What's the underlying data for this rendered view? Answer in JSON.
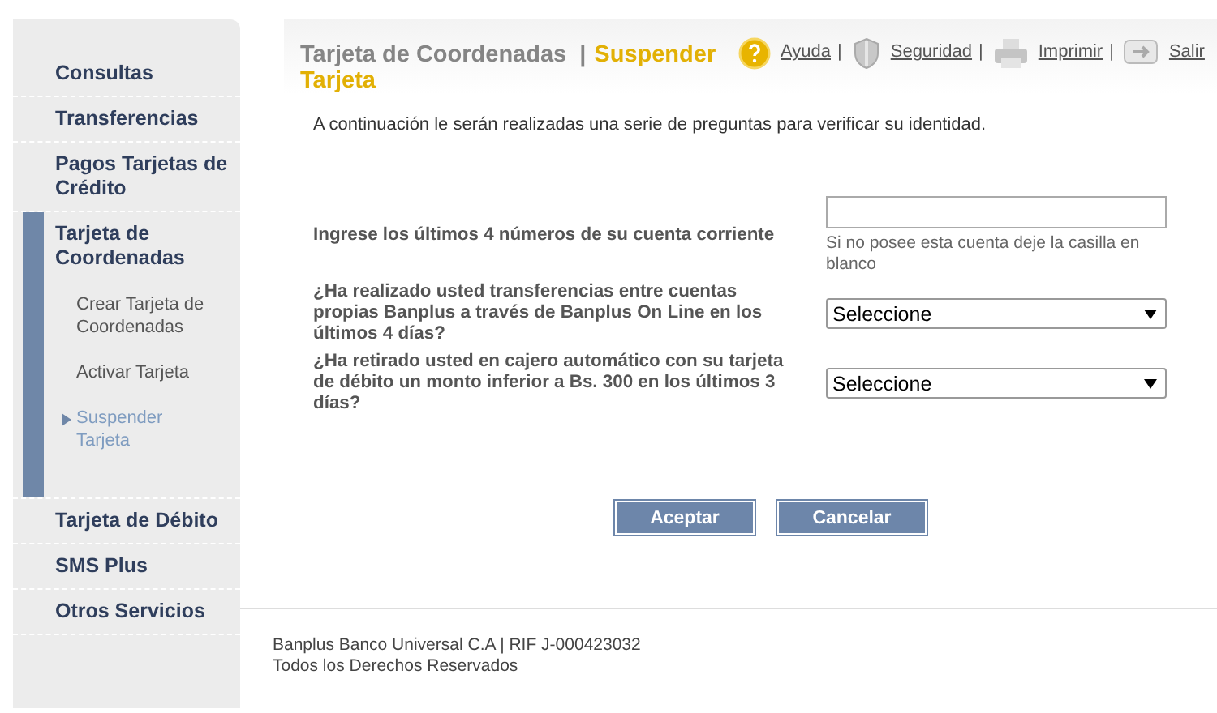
{
  "sidebar": {
    "items": [
      {
        "label": "Consultas",
        "expanded": false
      },
      {
        "label": "Transferencias",
        "expanded": false
      },
      {
        "label": "Pagos Tarjetas de Crédito",
        "expanded": false
      },
      {
        "label": "Tarjeta de Coordenadas",
        "expanded": true,
        "children": [
          {
            "label": "Crear Tarjeta de Coordenadas",
            "selected": false
          },
          {
            "label": "Activar Tarjeta",
            "selected": false
          },
          {
            "label": "Suspender Tarjeta",
            "selected": true
          }
        ]
      },
      {
        "label": "Tarjeta de Débito",
        "expanded": false
      },
      {
        "label": "SMS Plus",
        "expanded": false
      },
      {
        "label": "Otros Servicios",
        "expanded": false
      }
    ]
  },
  "header": {
    "title": "Tarjeta de Coordenadas",
    "separator": "|",
    "subtitle": "Suspender Tarjeta",
    "links": [
      {
        "kind": "help",
        "label": "Ayuda"
      },
      {
        "kind": "security",
        "label": "Seguridad"
      },
      {
        "kind": "print",
        "label": "Imprimir"
      },
      {
        "kind": "exit",
        "label": "Salir"
      }
    ],
    "link_separator": "|"
  },
  "intro": "A continuación le serán realizadas una serie de preguntas para verificar su identidad.",
  "questions": [
    {
      "kind": "text",
      "label": "Ingrese los últimos 4 números de su cuenta corriente",
      "hint": "Si no posee esta cuenta deje la casilla en blanco"
    },
    {
      "kind": "select",
      "label": "¿Ha realizado usted transferencias entre cuentas propias Banplus a través de Banplus On Line en los últimos 4 días?",
      "value": "Seleccione"
    },
    {
      "kind": "select",
      "label": "¿Ha retirado usted en cajero automático con su tarjeta de débito un monto inferior a Bs. 300 en los últimos 3 días?",
      "value": "Seleccione"
    }
  ],
  "buttons": [
    "Aceptar",
    "Cancelar"
  ],
  "footer": [
    "Banplus Banco Universal C.A | RIF J-000423032",
    "Todos los Derechos Reservados"
  ]
}
